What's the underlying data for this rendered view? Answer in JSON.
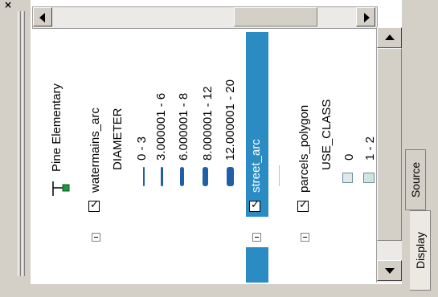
{
  "window": {
    "close_glyph": "×"
  },
  "tabs": [
    {
      "label": "Display",
      "selected": true
    },
    {
      "label": "Source",
      "selected": false
    }
  ],
  "toc": {
    "dataframe": {
      "name": "Pine Elementary",
      "icon": "dataframe-icon"
    },
    "layers": [
      {
        "name": "watermains_arc",
        "checked": true,
        "expanded": true,
        "field": "DIAMETER",
        "classes": [
          "0 - 3",
          "3.000001 - 6",
          "6.000001 - 8",
          "8.000001 - 12",
          "12.000001 - 20"
        ]
      },
      {
        "name": "street_arc",
        "checked": true,
        "expanded": true,
        "selected": true
      },
      {
        "name": "parcels_polygon",
        "checked": true,
        "expanded": true,
        "field": "USE_CLASS",
        "classes": [
          "0",
          "1 - 2"
        ]
      }
    ]
  },
  "colors": {
    "selection": "#2b8cc4",
    "symbol_line": "#1f5fa8",
    "parcel_fill_0": "#dfe9e6",
    "parcel_fill_1": "#cfe6de"
  }
}
